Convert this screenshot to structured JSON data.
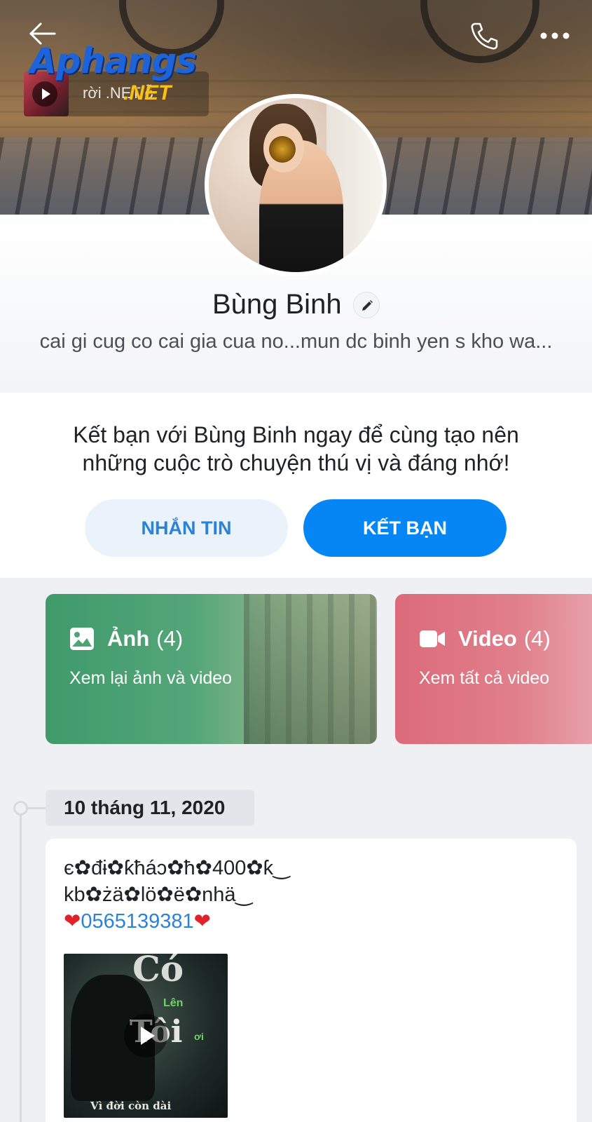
{
  "header": {
    "watermark_main": "Aphangs",
    "watermark_net": ".NET",
    "music_text": "rời .NET ỗ"
  },
  "profile": {
    "name": "Bùng Binh",
    "bio": "cai gi cug co cai gia cua no...mun dc binh yen s kho wa..."
  },
  "friend_cta": {
    "message": "Kết bạn với Bùng Binh ngay để cùng tạo nên những cuộc trò chuyện thú vị và đáng nhớ!",
    "message_button": "NHẮN TIN",
    "add_friend_button": "KẾT BẠN"
  },
  "media_cards": [
    {
      "title": "Ảnh",
      "count": "(4)",
      "subtitle": "Xem lại ảnh và video",
      "icon": "image-icon",
      "color": "#3f9a6a"
    },
    {
      "title": "Video",
      "count": "(4)",
      "subtitle": "Xem tất cả video",
      "icon": "video-camera-icon",
      "color": "#dc6b7a"
    }
  ],
  "timeline": {
    "date": "10 tháng 11, 2020",
    "post": {
      "line1": "є✿đɨ✿ƙħáɔ✿ħ✿400✿ƙ‿",
      "line2": "kb✿żä✿lö✿ë✿nhä‿",
      "heart": "❤",
      "phone": "0565139381",
      "media_text": {
        "top": "Có",
        "len": "Lên",
        "toi": "Tôi",
        "oi": "ơi",
        "caption": "Vì đời còn dài"
      }
    }
  },
  "colors": {
    "accent": "#0686f4",
    "link": "#2b82d6"
  }
}
